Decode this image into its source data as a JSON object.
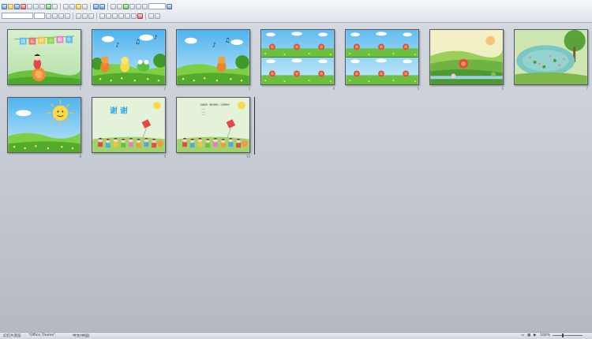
{
  "view": "slide-sorter",
  "slides": [
    {
      "number": "1",
      "title_chars": [
        "快",
        "乐",
        "的",
        "小",
        "蜗",
        "牛"
      ]
    },
    {
      "number": "2"
    },
    {
      "number": "3"
    },
    {
      "number": "4"
    },
    {
      "number": "5"
    },
    {
      "number": "6"
    },
    {
      "number": "7"
    },
    {
      "number": "8"
    },
    {
      "number": "9",
      "thanks_text": "谢 谢"
    },
    {
      "number": "10",
      "text_lines": [
        "活动延伸：请你回家后，与爸爸妈妈",
        "——",
        "——",
        "——"
      ]
    }
  ],
  "status": {
    "view_label": "幻灯片浏览",
    "theme": "\"Office Theme\"",
    "language": "中文(中国)",
    "zoom": "100%"
  },
  "colors": {
    "background": "#c8cdd5",
    "sky": "#7ec8f0",
    "grass": "#6cc040"
  }
}
